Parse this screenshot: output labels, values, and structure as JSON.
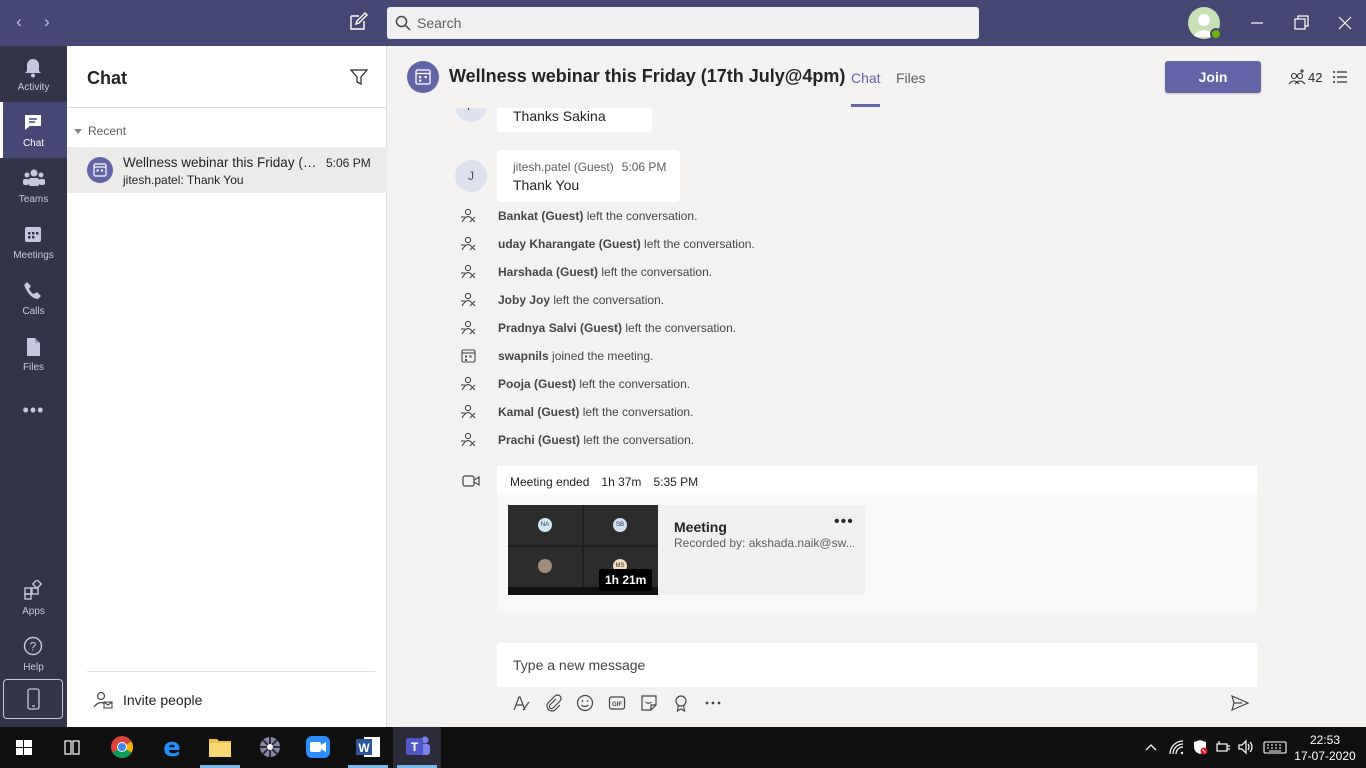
{
  "window": {
    "search_placeholder": "Search"
  },
  "rail": {
    "items": [
      {
        "label": "Activity",
        "icon": "bell-icon"
      },
      {
        "label": "Chat",
        "icon": "chat-icon"
      },
      {
        "label": "Teams",
        "icon": "teams-icon"
      },
      {
        "label": "Meetings",
        "icon": "calendar-icon"
      },
      {
        "label": "Calls",
        "icon": "phone-icon"
      },
      {
        "label": "Files",
        "icon": "file-icon"
      }
    ],
    "more_label": "•••",
    "bottom": [
      {
        "label": "Apps",
        "icon": "apps-icon"
      },
      {
        "label": "Help",
        "icon": "help-icon"
      }
    ]
  },
  "chat_panel": {
    "title": "Chat",
    "section": "Recent",
    "conversations": [
      {
        "name": "Wellness webinar this Friday (17th July@4pm)",
        "time": "5:06 PM",
        "preview": "jitesh.patel: Thank You"
      }
    ],
    "invite_label": "Invite people"
  },
  "conversation": {
    "title": "Wellness webinar this Friday (17th July@4pm)",
    "tabs": [
      {
        "label": "Chat",
        "active": true
      },
      {
        "label": "Files",
        "active": false
      }
    ],
    "join_label": "Join",
    "participant_count": "42",
    "messages": [
      {
        "initial": "P",
        "author": "",
        "time": "",
        "text": "Thanks Sakina"
      },
      {
        "initial": "J",
        "author": "jitesh.patel (Guest)",
        "time": "5:06 PM",
        "text": "Thank You"
      }
    ],
    "events": [
      {
        "name": "Bankat (Guest)",
        "action": " left the conversation.",
        "icon": "left-conversation-icon"
      },
      {
        "name": "uday Kharangate (Guest)",
        "action": " left the conversation.",
        "icon": "left-conversation-icon"
      },
      {
        "name": "Harshada (Guest)",
        "action": " left the conversation.",
        "icon": "left-conversation-icon"
      },
      {
        "name": "Joby Joy",
        "action": " left the conversation.",
        "icon": "left-conversation-icon"
      },
      {
        "name": "Pradnya Salvi (Guest)",
        "action": " left the conversation.",
        "icon": "left-conversation-icon"
      },
      {
        "name": "swapnils",
        "action": " joined the meeting.",
        "icon": "joined-meeting-icon"
      },
      {
        "name": "Pooja (Guest)",
        "action": " left the conversation.",
        "icon": "left-conversation-icon"
      },
      {
        "name": "Kamal (Guest)",
        "action": " left the conversation.",
        "icon": "left-conversation-icon"
      },
      {
        "name": "Prachi (Guest)",
        "action": " left the conversation.",
        "icon": "left-conversation-icon"
      }
    ],
    "meeting_ended": {
      "label": "Meeting ended",
      "duration": "1h 37m",
      "time": "5:35 PM"
    },
    "recording": {
      "title": "Meeting",
      "recorded_by": "Recorded by: akshada.naik@sw...",
      "duration": "1h 21m",
      "tiles": [
        "NA",
        "SB",
        "",
        "MS"
      ]
    },
    "composer_placeholder": "Type a new message"
  },
  "taskbar": {
    "time": "22:53",
    "date": "17-07-2020"
  },
  "colors": {
    "brand": "#6264a7",
    "titlebar": "#464775",
    "rail": "#33344a",
    "background": "#f3f2f1"
  }
}
